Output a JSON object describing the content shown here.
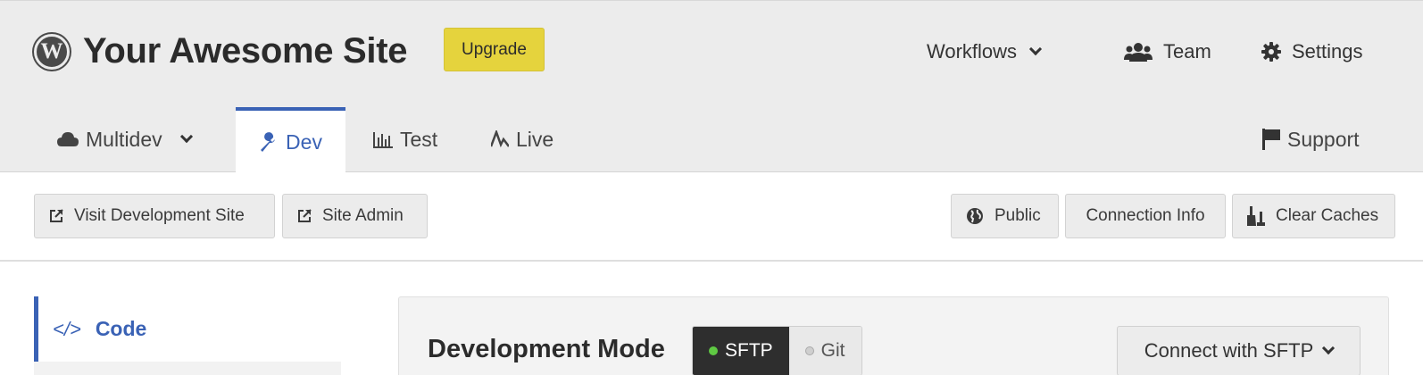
{
  "site": {
    "title": "Your Awesome Site",
    "upgrade_label": "Upgrade",
    "logo_letter": "W"
  },
  "top_nav": {
    "workflows": "Workflows",
    "team": "Team",
    "settings": "Settings"
  },
  "env_tabs": {
    "multidev": "Multidev",
    "dev": "Dev",
    "test": "Test",
    "live": "Live",
    "support": "Support"
  },
  "actions": {
    "visit_dev_site": "Visit Development Site",
    "site_admin": "Site Admin",
    "public": "Public",
    "connection_info": "Connection Info",
    "clear_caches": "Clear Caches"
  },
  "sidebar": {
    "code_icon": "</>",
    "code_label": "Code"
  },
  "dev_mode": {
    "title": "Development Mode",
    "options": [
      "SFTP",
      "Git"
    ],
    "selected": "SFTP",
    "connect_label": "Connect with SFTP"
  },
  "icons": {
    "logo": "wordpress-logo-icon",
    "workflows": "chevron-down-icon",
    "team": "team-icon",
    "settings": "gear-icon",
    "multidev": "cloud-icon",
    "dev": "wrench-icon",
    "test": "bar-chart-icon",
    "live": "pulse-icon",
    "support": "flag-icon",
    "external": "external-link-icon",
    "public": "globe-icon",
    "clear": "broom-icon",
    "code": "code-icon"
  },
  "colors": {
    "accent": "#3a62b5",
    "upgrade": "#e5d33d",
    "active_mode": "#2e2e2e",
    "sftp_dot": "#5fc943"
  }
}
